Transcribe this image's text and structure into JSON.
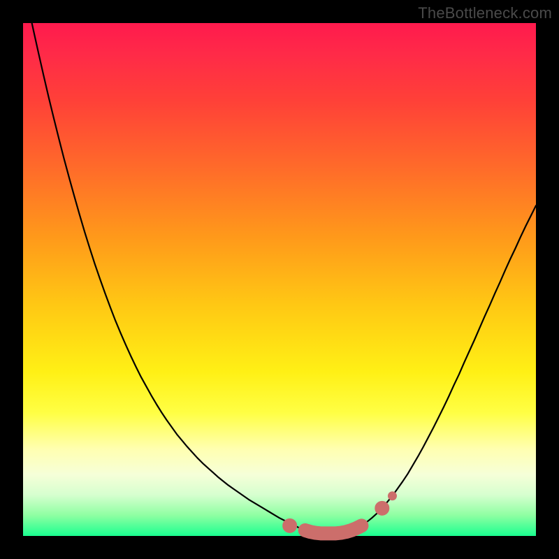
{
  "watermark": "TheBottleneck.com",
  "colors": {
    "frame": "#000000",
    "curve_stroke": "#000000",
    "marker_fill": "#cc6e6b",
    "marker_stroke": "#cc6e6b"
  },
  "chart_data": {
    "type": "line",
    "title": "",
    "xlabel": "",
    "ylabel": "",
    "xlim": [
      0,
      100
    ],
    "ylim": [
      0,
      100
    ],
    "grid": false,
    "legend": false,
    "x": [
      0,
      1,
      2,
      3,
      4,
      5,
      6,
      7,
      8,
      9,
      10,
      11,
      12,
      13,
      14,
      15,
      16,
      17,
      18,
      19,
      20,
      21,
      22,
      23,
      24,
      25,
      26,
      27,
      28,
      29,
      30,
      31,
      32,
      33,
      34,
      35,
      36,
      37,
      38,
      39,
      40,
      41,
      42,
      43,
      44,
      45,
      46,
      47,
      48,
      49,
      50,
      51,
      52,
      53,
      54,
      55,
      56,
      57,
      58,
      59,
      60,
      61,
      62,
      63,
      64,
      65,
      66,
      67,
      68,
      69,
      70,
      71,
      72,
      73,
      74,
      75,
      76,
      77,
      78,
      79,
      80,
      81,
      82,
      83,
      84,
      85,
      86,
      87,
      88,
      89,
      90,
      91,
      92,
      93,
      94,
      95,
      96,
      97,
      98,
      99,
      100
    ],
    "values": [
      108.0,
      103.3,
      98.7,
      94.2,
      89.8,
      85.5,
      81.4,
      77.4,
      73.5,
      69.8,
      66.2,
      62.7,
      59.3,
      56.1,
      53.0,
      50.1,
      47.3,
      44.6,
      42.0,
      39.6,
      37.3,
      35.1,
      33.0,
      31.0,
      29.2,
      27.4,
      25.7,
      24.1,
      22.6,
      21.2,
      19.8,
      18.6,
      17.4,
      16.3,
      15.2,
      14.2,
      13.3,
      12.4,
      11.5,
      10.7,
      9.9,
      9.2,
      8.5,
      7.8,
      7.1,
      6.5,
      5.9,
      5.3,
      4.7,
      4.1,
      3.5,
      3.0,
      2.5,
      2.0,
      1.5,
      1.1,
      0.8,
      0.6,
      0.5,
      0.5,
      0.5,
      0.5,
      0.6,
      0.8,
      1.1,
      1.5,
      2.0,
      2.7,
      3.5,
      4.4,
      5.4,
      6.6,
      7.8,
      9.2,
      10.6,
      12.1,
      13.8,
      15.5,
      17.3,
      19.2,
      21.1,
      23.1,
      25.1,
      27.2,
      29.4,
      31.5,
      33.8,
      36.0,
      38.2,
      40.5,
      42.8,
      45.0,
      47.3,
      49.5,
      51.8,
      54.0,
      56.1,
      58.3,
      60.4,
      62.4,
      64.4
    ],
    "markers": {
      "ends_x": [
        52,
        70
      ],
      "ends_y": [
        2.0,
        5.4
      ],
      "flat_x": [
        55,
        56,
        57,
        58,
        59,
        60,
        61,
        62,
        63,
        64,
        65,
        66
      ],
      "flat_y": [
        1.1,
        0.8,
        0.6,
        0.5,
        0.5,
        0.5,
        0.5,
        0.6,
        0.8,
        1.1,
        1.5,
        2.0
      ],
      "outlier_x": 72,
      "outlier_y": 7.8,
      "end_radius": 10,
      "flat_radius": 10,
      "outlier_radius": 6
    }
  }
}
